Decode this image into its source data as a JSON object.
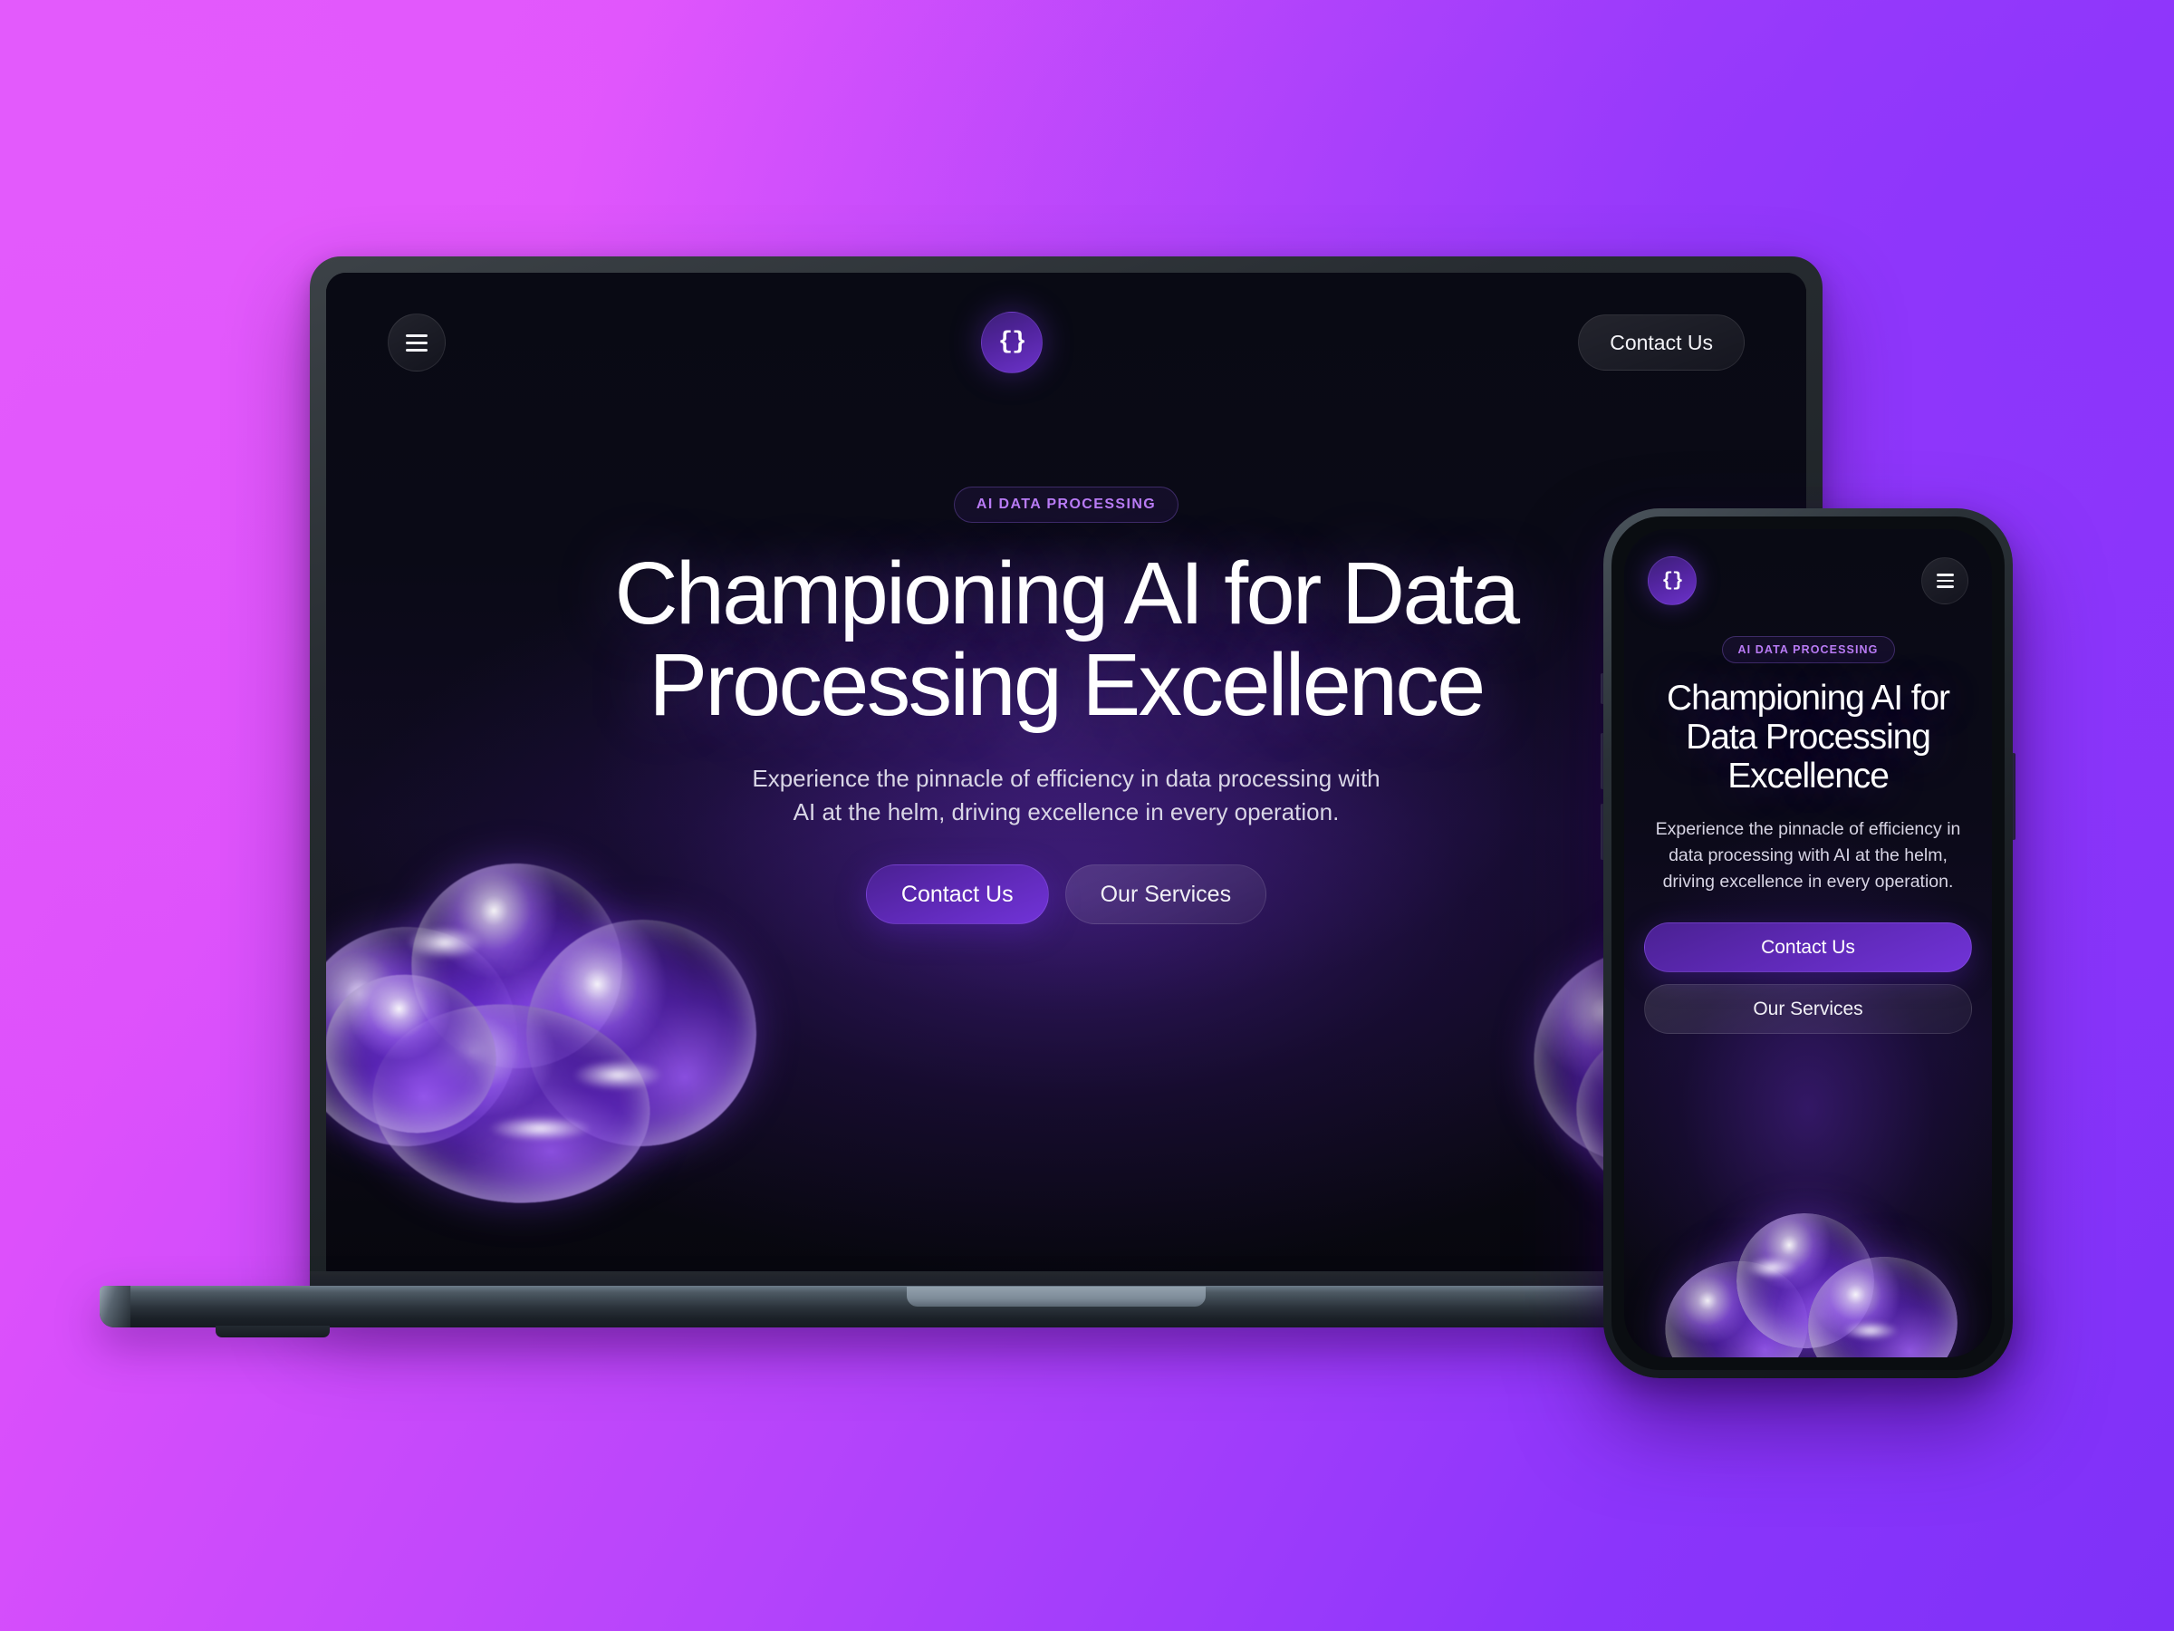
{
  "background": {
    "gradient_from": "#e457fc",
    "gradient_to": "#7e31f8"
  },
  "brand": {
    "accent": "#7133d8",
    "badge_color": "#b97bf5",
    "logo_glyph": "{}"
  },
  "desktop": {
    "nav": {
      "menu_label": "menu",
      "logo_glyph": "{}",
      "contact_label": "Contact Us"
    },
    "hero": {
      "badge": "AI DATA PROCESSING",
      "title": "Championing AI for Data Processing Excellence",
      "subtitle": "Experience the pinnacle of efficiency in data processing with AI at the helm, driving excellence in every operation.",
      "primary_cta": "Contact Us",
      "secondary_cta": "Our Services"
    }
  },
  "mobile": {
    "nav": {
      "logo_glyph": "{}",
      "menu_label": "menu"
    },
    "hero": {
      "badge": "AI DATA PROCESSING",
      "title": "Championing AI for Data Processing Excellence",
      "subtitle": "Experience the pinnacle of efficiency in data processing with AI at the helm, driving excellence in every operation.",
      "primary_cta": "Contact Us",
      "secondary_cta": "Our Services"
    }
  }
}
